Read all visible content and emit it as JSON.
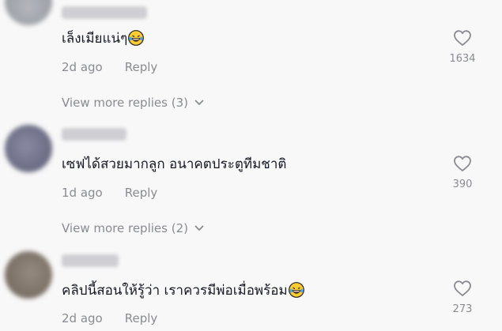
{
  "comments": [
    {
      "text": "เล็งเมียแน่ๆ",
      "emoji": "laughing-tears-emoji",
      "time": "2d ago",
      "reply_label": "Reply",
      "likes": "1634",
      "view_more": "View more replies (3)"
    },
    {
      "text": "เซฟได้สวยมากลูก อนาคตประตูทีมชาติ",
      "emoji": "",
      "time": "1d ago",
      "reply_label": "Reply",
      "likes": "390",
      "view_more": "View more replies (2)"
    },
    {
      "text": "คลิปนี้สอนให้รู้ว่า เราควรมีพ่อเมื่อพร้อม",
      "emoji": "laughing-tears-emoji",
      "time": "2d ago",
      "reply_label": "Reply",
      "likes": "273"
    }
  ],
  "icons": {
    "like": "heart-outline-icon",
    "expand": "chevron-down-icon"
  },
  "colors": {
    "background": "#f8f8f8",
    "text": "#161823",
    "secondary": "#8a8b91"
  }
}
